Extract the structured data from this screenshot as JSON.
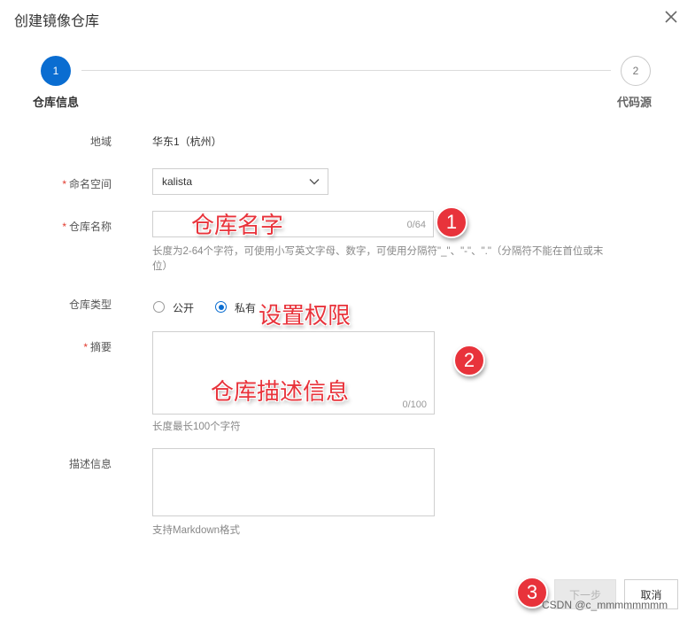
{
  "dialog": {
    "title": "创建镜像仓库",
    "steps": [
      {
        "number": "1",
        "label": "仓库信息"
      },
      {
        "number": "2",
        "label": "代码源"
      }
    ]
  },
  "form": {
    "region": {
      "label": "地域",
      "value": "华东1（杭州）"
    },
    "namespace": {
      "required_mark": "*",
      "label": "命名空间",
      "value": "kalista"
    },
    "repo_name": {
      "required_mark": "*",
      "label": "仓库名称",
      "value": "",
      "counter": "0/64",
      "hint": "长度为2-64个字符，可使用小写英文字母、数字，可使用分隔符\"_\"、\"-\"、\".\"（分隔符不能在首位或末位）"
    },
    "repo_type": {
      "label": "仓库类型",
      "options": [
        "公开",
        "私有"
      ],
      "selected": "私有"
    },
    "summary": {
      "required_mark": "*",
      "label": "摘要",
      "counter": "0/100",
      "hint": "长度最长100个字符"
    },
    "description": {
      "label": "描述信息",
      "hint": "支持Markdown格式"
    }
  },
  "buttons": {
    "next": "下一步",
    "cancel": "取消"
  },
  "annotations": {
    "repo_name_note": "仓库名字",
    "permission_note": "设置权限",
    "summary_note": "仓库描述信息",
    "badges": [
      "1",
      "2",
      "3"
    ],
    "accent_color": "#e8333b"
  },
  "watermark": "CSDN @c_mmmmmmmm",
  "colors": {
    "primary": "#0a6dd1",
    "required": "#e23a2d"
  }
}
